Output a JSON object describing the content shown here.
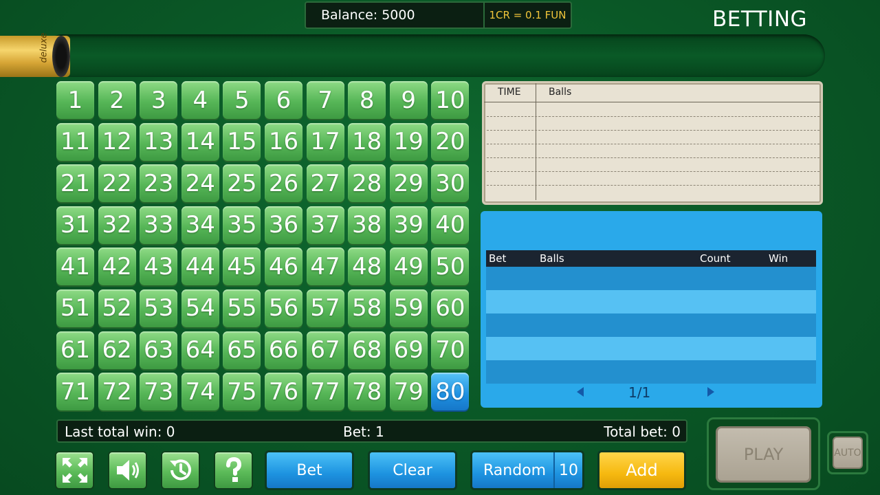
{
  "header": {
    "balance": "Balance: 5000",
    "rate": "1CR = 0.1 FUN",
    "title": "BETTING"
  },
  "brand": "deluxe",
  "grid": {
    "numbers": [
      "1",
      "2",
      "3",
      "4",
      "5",
      "6",
      "7",
      "8",
      "9",
      "10",
      "11",
      "12",
      "13",
      "14",
      "15",
      "16",
      "17",
      "18",
      "19",
      "20",
      "21",
      "22",
      "23",
      "24",
      "25",
      "26",
      "27",
      "28",
      "29",
      "30",
      "31",
      "32",
      "33",
      "34",
      "35",
      "36",
      "37",
      "38",
      "39",
      "40",
      "41",
      "42",
      "43",
      "44",
      "45",
      "46",
      "47",
      "48",
      "49",
      "50",
      "51",
      "52",
      "53",
      "54",
      "55",
      "56",
      "57",
      "58",
      "59",
      "60",
      "61",
      "62",
      "63",
      "64",
      "65",
      "66",
      "67",
      "68",
      "69",
      "70",
      "71",
      "72",
      "73",
      "74",
      "75",
      "76",
      "77",
      "78",
      "79",
      "80"
    ],
    "selected": [
      "80"
    ]
  },
  "history": {
    "col_time": "TIME",
    "col_balls": "Balls"
  },
  "bets_table": {
    "col_bet": "Bet",
    "col_balls": "Balls",
    "col_count": "Count",
    "col_win": "Win",
    "page": "1/1"
  },
  "status": {
    "last_win": "Last total win: 0",
    "bet": "Bet: 1",
    "total_bet": "Total bet: 0"
  },
  "buttons": {
    "bet": "Bet",
    "clear": "Clear",
    "random": "Random",
    "random_count": "10",
    "add": "Add",
    "play": "PLAY",
    "auto": "AUTO"
  },
  "icons": [
    "fullscreen-icon",
    "sound-icon",
    "history-icon",
    "help-icon"
  ],
  "colors": {
    "table_green": "#0a5726",
    "cell_green": "#56b657",
    "cell_selected": "#1e8fe0",
    "accent_yellow": "#f6b910",
    "panel_blue": "#2aa9ea"
  }
}
